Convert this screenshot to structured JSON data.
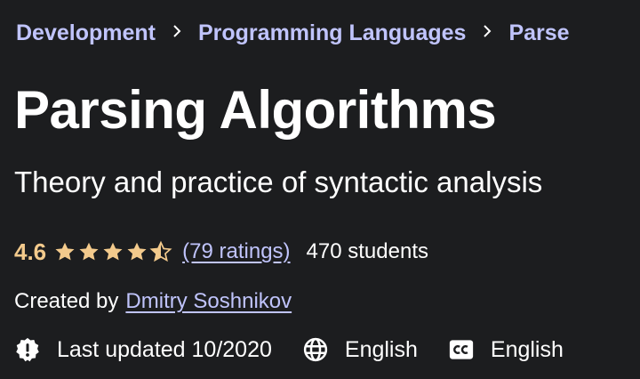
{
  "breadcrumb": {
    "items": [
      {
        "label": "Development"
      },
      {
        "label": "Programming Languages"
      },
      {
        "label": "Parse"
      }
    ],
    "separator": "›"
  },
  "course": {
    "title": "Parsing Algorithms",
    "subtitle": "Theory and practice of syntactic analysis",
    "rating": {
      "value": "4.6",
      "stars": 4.6,
      "ratings_count": "(79 ratings)",
      "students": "470 students"
    },
    "created_by_label": "Created by",
    "author": "Dmitry Soshnikov",
    "last_updated": "Last updated 10/2020",
    "language": "English",
    "captions": "English"
  },
  "icons": {
    "alert": "alert-badge-icon",
    "globe": "globe-icon",
    "captions": "closed-captions-icon"
  },
  "colors": {
    "background": "#1c1d1f",
    "link": "#c0c4fc",
    "rating": "#f3ca8c",
    "text": "#ffffff"
  }
}
